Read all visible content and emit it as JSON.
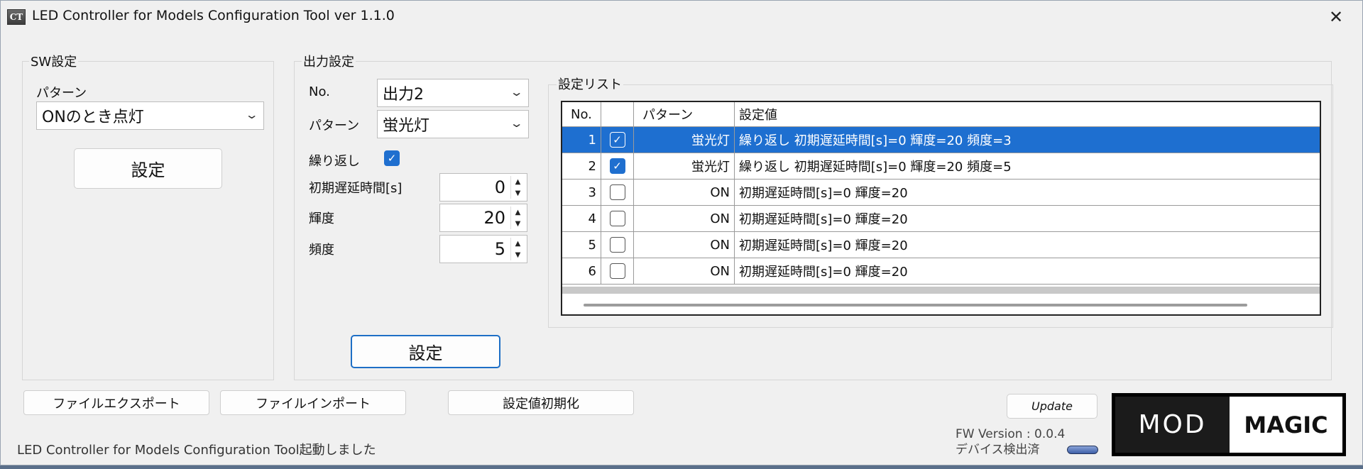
{
  "window": {
    "title": "LED Controller for Models Configuration Tool ver 1.1.0",
    "icon_text": "CT",
    "close_glyph": "✕"
  },
  "sw_group": {
    "label": "SW設定",
    "pattern_label": "パターン",
    "pattern_value": "ONのとき点灯",
    "set_button": "設定"
  },
  "output_group": {
    "label": "出力設定",
    "no_label": "No.",
    "no_value": "出力2",
    "pattern_label": "パターン",
    "pattern_value": "蛍光灯",
    "repeat_label": "繰り返し",
    "repeat_checked": true,
    "delay_label": "初期遅延時間[s]",
    "delay_value": "0",
    "brightness_label": "輝度",
    "brightness_value": "20",
    "frequency_label": "頻度",
    "frequency_value": "5",
    "set_button": "設定"
  },
  "settings_list": {
    "label": "設定リスト",
    "columns": [
      "No.",
      "",
      "パターン",
      "設定値"
    ],
    "rows": [
      {
        "no": "1",
        "checked": true,
        "pattern": "蛍光灯",
        "value": "繰り返し 初期遅延時間[s]=0 輝度=20 頻度=3",
        "selected": true
      },
      {
        "no": "2",
        "checked": true,
        "pattern": "蛍光灯",
        "value": "繰り返し 初期遅延時間[s]=0 輝度=20 頻度=5",
        "selected": false
      },
      {
        "no": "3",
        "checked": false,
        "pattern": "ON",
        "value": "初期遅延時間[s]=0 輝度=20",
        "selected": false
      },
      {
        "no": "4",
        "checked": false,
        "pattern": "ON",
        "value": "初期遅延時間[s]=0 輝度=20",
        "selected": false
      },
      {
        "no": "5",
        "checked": false,
        "pattern": "ON",
        "value": "初期遅延時間[s]=0 輝度=20",
        "selected": false
      },
      {
        "no": "6",
        "checked": false,
        "pattern": "ON",
        "value": "初期遅延時間[s]=0 輝度=20",
        "selected": false
      }
    ]
  },
  "bottom_buttons": {
    "export": "ファイルエクスポート",
    "import": "ファイルインポート",
    "reset": "設定値初期化",
    "update": "Update"
  },
  "status": {
    "message": "LED Controller for Models Configuration Tool起動しました",
    "fw_version": "FW Version : 0.0.4",
    "device_status": "デバイス検出済"
  },
  "logo": {
    "left": "MOD",
    "right": "MAGIC"
  },
  "colors": {
    "selection": "#1e6fd0",
    "checkbox_on": "#1f6fcf",
    "accent_border": "#1e6fc6"
  }
}
